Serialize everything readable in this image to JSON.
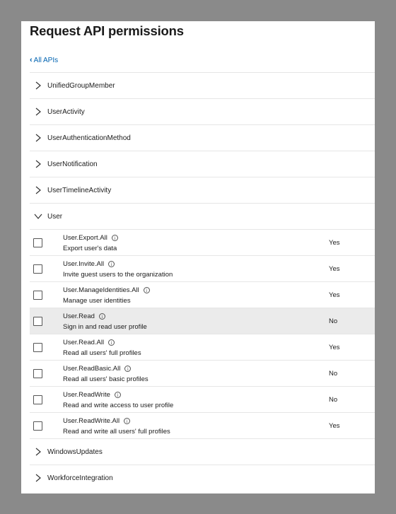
{
  "page": {
    "title": "Request API permissions"
  },
  "nav": {
    "back_label": "All APIs"
  },
  "groups_before": [
    {
      "label": "UnifiedGroupMember"
    },
    {
      "label": "UserActivity"
    },
    {
      "label": "UserAuthenticationMethod"
    },
    {
      "label": "UserNotification"
    },
    {
      "label": "UserTimelineActivity"
    }
  ],
  "expanded_group": {
    "label": "User",
    "permissions": [
      {
        "name": "User.Export.All",
        "description": "Export user's data",
        "admin_consent": "Yes",
        "checked": false
      },
      {
        "name": "User.Invite.All",
        "description": "Invite guest users to the organization",
        "admin_consent": "Yes",
        "checked": false
      },
      {
        "name": "User.ManageIdentities.All",
        "description": "Manage user identities",
        "admin_consent": "Yes",
        "checked": false
      },
      {
        "name": "User.Read",
        "description": "Sign in and read user profile",
        "admin_consent": "No",
        "checked": false,
        "highlighted": true
      },
      {
        "name": "User.Read.All",
        "description": "Read all users' full profiles",
        "admin_consent": "Yes",
        "checked": false
      },
      {
        "name": "User.ReadBasic.All",
        "description": "Read all users' basic profiles",
        "admin_consent": "No",
        "checked": false
      },
      {
        "name": "User.ReadWrite",
        "description": "Read and write access to user profile",
        "admin_consent": "No",
        "checked": false
      },
      {
        "name": "User.ReadWrite.All",
        "description": "Read and write all users' full profiles",
        "admin_consent": "Yes",
        "checked": false
      }
    ]
  },
  "groups_after": [
    {
      "label": "WindowsUpdates"
    },
    {
      "label": "WorkforceIntegration"
    }
  ],
  "colors": {
    "link": "#0063b1",
    "highlight_row": "#ebebeb",
    "frame": "#8a8a8a"
  },
  "icons": {
    "collapsed": "chevron-right-icon",
    "expanded": "chevron-down-icon",
    "info": "info-icon",
    "back": "chevron-left-icon"
  }
}
